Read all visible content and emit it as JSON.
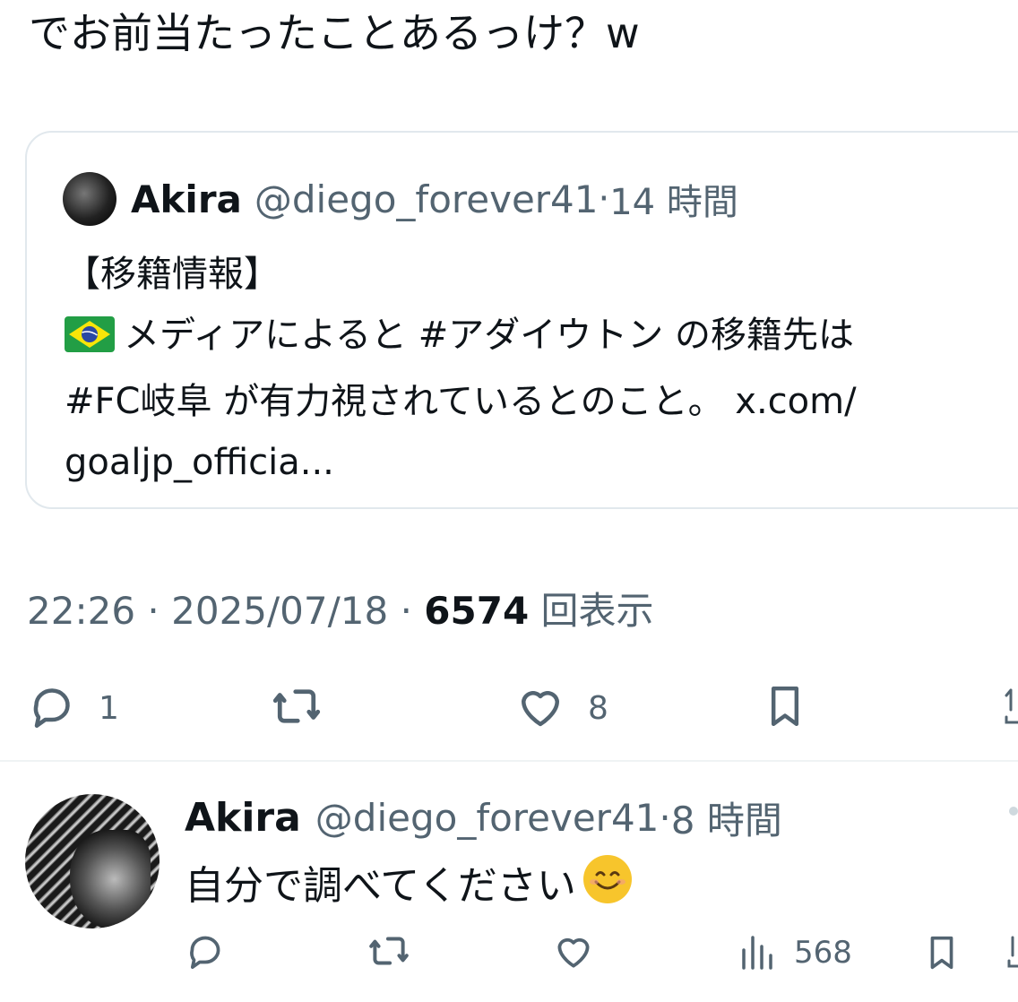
{
  "tweet": {
    "text": "でお前当たったことあるっけ？w",
    "quote": {
      "name": "Akira",
      "handle": "@diego_forever41",
      "separator": "·",
      "time": "14 時間",
      "lines": [
        "【移籍情報】",
        "メディアによると #アダイウトン の移籍先は",
        "#FC岐阜 が有力視されているとのこと。 x.com/",
        "goaljp_officia..."
      ],
      "flag_icon": "brazil-flag-icon"
    },
    "meta": {
      "time": "22:26",
      "separator1": "·",
      "date": "2025/07/18",
      "separator2": "·",
      "views_count": "6574",
      "views_label": "回表示"
    },
    "actions": {
      "reply_count": "1",
      "like_count": "8"
    }
  },
  "reply": {
    "name": "Akira",
    "handle": "@diego_forever41",
    "separator": "·",
    "time": "8 時間",
    "text": "自分で調べてください",
    "emoji_icon": "smiling-face-icon",
    "views_count": "568"
  },
  "colors": {
    "text": "#0f1419",
    "secondary": "#536471",
    "border": "#e1e8ed",
    "emoji": "#f7c52c"
  }
}
